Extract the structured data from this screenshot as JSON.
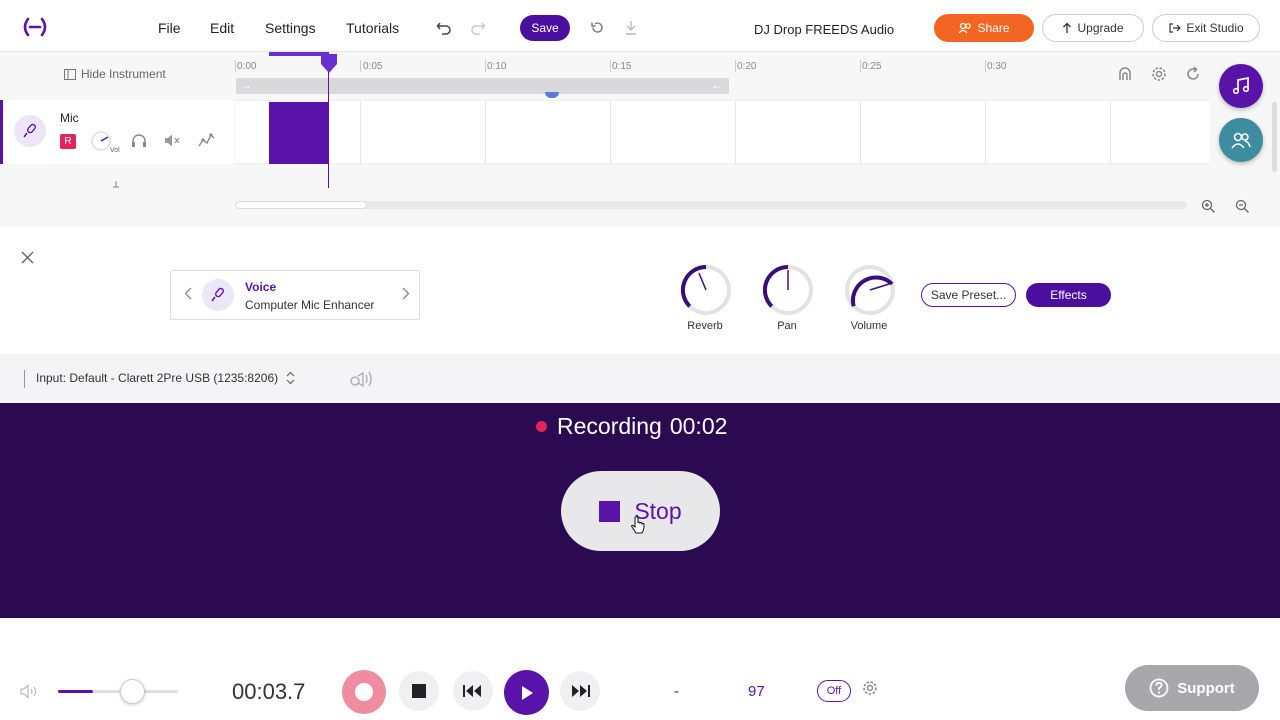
{
  "topbar": {
    "menu": [
      "File",
      "Edit",
      "Settings",
      "Tutorials"
    ],
    "save_label": "Save",
    "project_title": "DJ Drop FREEDS Audio",
    "share_label": "Share",
    "upgrade_label": "Upgrade",
    "exit_label": "Exit Studio"
  },
  "timeline": {
    "hide_instrument_label": "Hide Instrument",
    "ticks": [
      "0:00",
      "0:05",
      "0:10",
      "0:15",
      "0:20",
      "0:25",
      "0:30"
    ]
  },
  "track": {
    "name": "Mic",
    "record_badge": "R",
    "vol_label": "Vol"
  },
  "instrument": {
    "category": "Voice",
    "preset": "Computer Mic Enhancer",
    "knobs": [
      "Reverb",
      "Pan",
      "Volume"
    ],
    "save_preset_label": "Save Preset...",
    "effects_label": "Effects"
  },
  "input": {
    "label": "Input: Default - Clarett 2Pre USB (1235:8206)"
  },
  "recording": {
    "status_label": "Recording",
    "elapsed": "00:02",
    "stop_label": "Stop"
  },
  "transport": {
    "time": "00:03.7",
    "key": "-",
    "tempo": "97",
    "metronome": "Off",
    "support_label": "Support"
  },
  "colors": {
    "accent": "#5a13a8",
    "share": "#f26522",
    "rec_panel": "#2b0a52",
    "record_red": "#e0255a"
  }
}
